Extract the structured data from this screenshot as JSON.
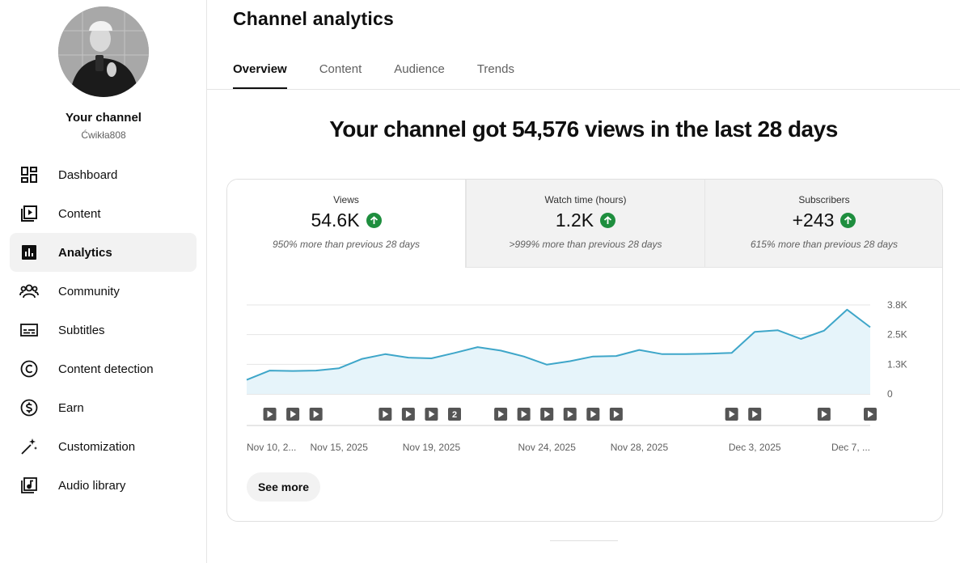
{
  "channel": {
    "name": "Your channel",
    "handle": "Ćwikła808"
  },
  "sidebar": {
    "items": [
      {
        "label": "Dashboard",
        "icon": "dashboard-icon"
      },
      {
        "label": "Content",
        "icon": "content-icon"
      },
      {
        "label": "Analytics",
        "icon": "analytics-icon",
        "active": true
      },
      {
        "label": "Community",
        "icon": "community-icon"
      },
      {
        "label": "Subtitles",
        "icon": "subtitles-icon"
      },
      {
        "label": "Content detection",
        "icon": "copyright-icon"
      },
      {
        "label": "Earn",
        "icon": "dollar-icon"
      },
      {
        "label": "Customization",
        "icon": "magic-wand-icon"
      },
      {
        "label": "Audio library",
        "icon": "audio-library-icon"
      }
    ]
  },
  "page": {
    "title": "Channel analytics"
  },
  "tabs": [
    {
      "label": "Overview",
      "active": true
    },
    {
      "label": "Content"
    },
    {
      "label": "Audience"
    },
    {
      "label": "Trends"
    }
  ],
  "headline": "Your channel got 54,576 views in the last 28 days",
  "metrics": [
    {
      "label": "Views",
      "value": "54.6K",
      "delta": "950% more than previous 28 days",
      "trend_icon": "arrow-up-icon"
    },
    {
      "label": "Watch time (hours)",
      "value": "1.2K",
      "delta": ">999% more than previous 28 days",
      "trend_icon": "arrow-up-icon"
    },
    {
      "label": "Subscribers",
      "value": "+243",
      "delta": "615% more than previous 28 days",
      "trend_icon": "arrow-up-icon"
    }
  ],
  "see_more_label": "See more",
  "colors": {
    "accent": "#3ea6c9",
    "area_fill": "#e6f4fa",
    "up_green": "#1e8e3e"
  },
  "chart_data": {
    "type": "area",
    "series": [
      {
        "values": [
          600,
          1000,
          980,
          1000,
          1100,
          1500,
          1700,
          1550,
          1520,
          1750,
          2000,
          1850,
          1600,
          1250,
          1400,
          1600,
          1620,
          1880,
          1700,
          1700,
          1720,
          1750,
          2650,
          2720,
          2350,
          2700,
          3600,
          2850
        ]
      }
    ],
    "y_ticks": [
      "0",
      "1.3K",
      "2.5K",
      "3.8K"
    ],
    "ylim": [
      0,
      3800
    ],
    "x_tick_labels": [
      "Nov 10, 2...",
      "Nov 15, 2025",
      "Nov 19, 2025",
      "Nov 24, 2025",
      "Nov 28, 2025",
      "Dec 3, 2025",
      "Dec 7, ..."
    ],
    "x_tick_indices": [
      0,
      4,
      8,
      13,
      17,
      22,
      26
    ],
    "video_markers": [
      {
        "day": 1,
        "label": ""
      },
      {
        "day": 2,
        "label": ""
      },
      {
        "day": 3,
        "label": ""
      },
      {
        "day": 6,
        "label": ""
      },
      {
        "day": 7,
        "label": ""
      },
      {
        "day": 8,
        "label": ""
      },
      {
        "day": 9,
        "label": "2"
      },
      {
        "day": 11,
        "label": ""
      },
      {
        "day": 12,
        "label": ""
      },
      {
        "day": 13,
        "label": ""
      },
      {
        "day": 14,
        "label": ""
      },
      {
        "day": 15,
        "label": ""
      },
      {
        "day": 16,
        "label": ""
      },
      {
        "day": 21,
        "label": ""
      },
      {
        "day": 22,
        "label": ""
      },
      {
        "day": 25,
        "label": ""
      },
      {
        "day": 27,
        "label": ""
      }
    ],
    "grid": true
  }
}
